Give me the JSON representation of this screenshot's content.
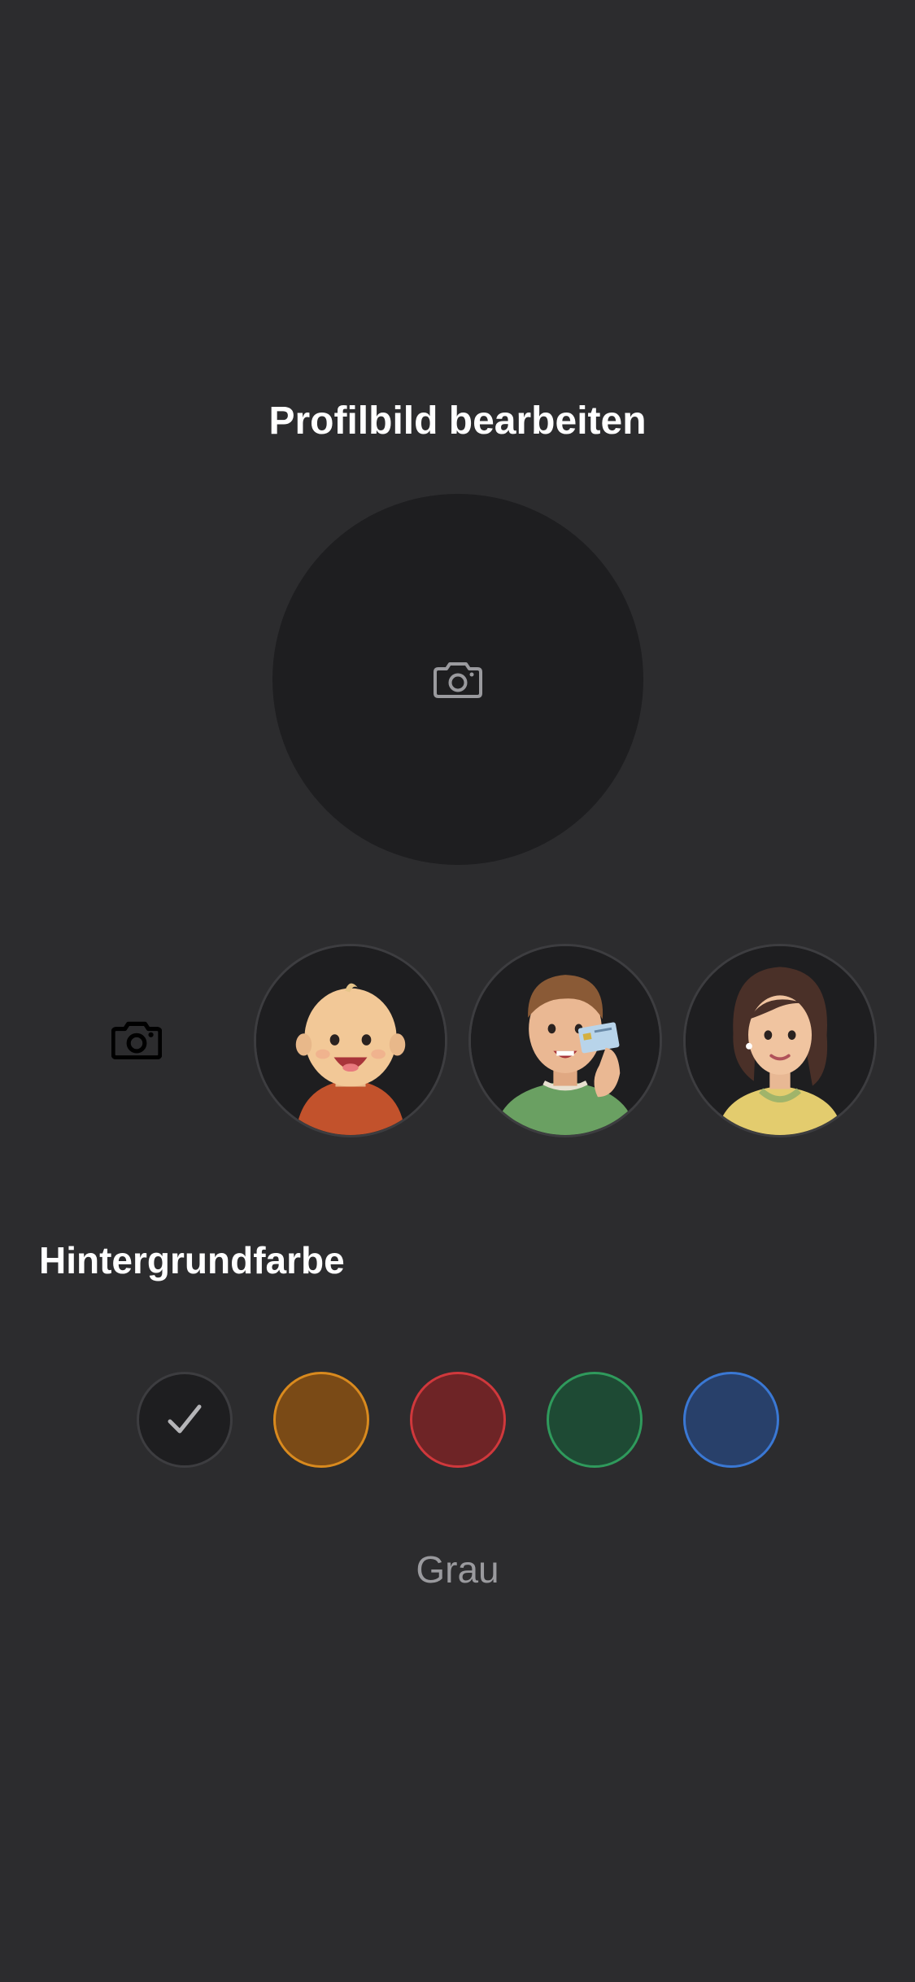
{
  "header": {
    "title": "Profilbild bearbeiten"
  },
  "preview": {
    "icon": "camera-icon"
  },
  "avatar_picker": {
    "upload_icon": "camera-icon",
    "avatars": [
      {
        "name": "avatar-baby"
      },
      {
        "name": "avatar-man-with-id-card"
      },
      {
        "name": "avatar-woman"
      }
    ]
  },
  "background_color": {
    "section_title": "Hintergrundfarbe",
    "selected_label": "Grau",
    "swatches": [
      {
        "name": "gray",
        "fill": "#1e1e20",
        "border": "#3d3d40",
        "selected": true
      },
      {
        "name": "orange",
        "fill": "#7a4a16",
        "border": "#d98a1e",
        "selected": false
      },
      {
        "name": "red",
        "fill": "#6e2426",
        "border": "#d0383c",
        "selected": false
      },
      {
        "name": "green",
        "fill": "#1e4a34",
        "border": "#2f9a5c",
        "selected": false
      },
      {
        "name": "blue",
        "fill": "#28406a",
        "border": "#3a78d4",
        "selected": false
      }
    ],
    "check_icon": "check-icon"
  }
}
